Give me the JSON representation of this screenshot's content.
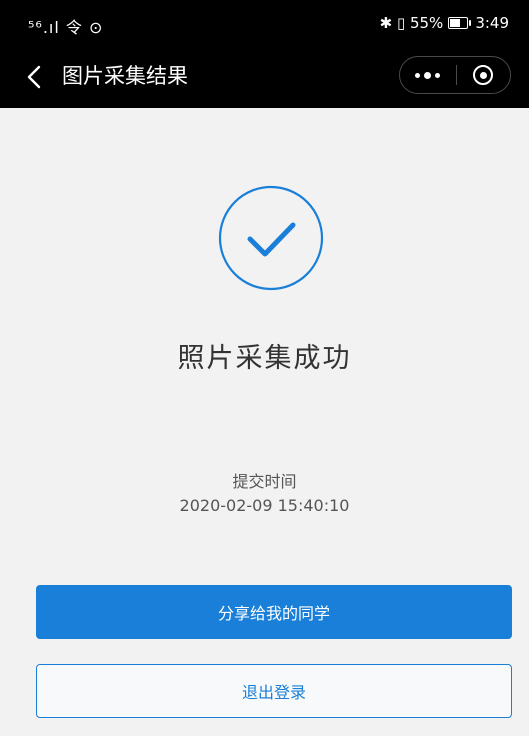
{
  "status_bar": {
    "left_icons": "⁵⁶.ıl 令 ⊙",
    "right_text": "✱ ▯ 55%",
    "time": "3:49"
  },
  "nav": {
    "title": "图片采集结果",
    "back_icon": "chevron-left-icon",
    "more_icon": "more-dots-icon",
    "close_icon": "target-icon"
  },
  "result": {
    "title": "照片采集成功",
    "icon": "check-circle-icon",
    "accent_color": "#1a7fd8"
  },
  "submission": {
    "label": "提交时间",
    "time": "2020-02-09 15:40:10"
  },
  "buttons": {
    "share_label": "分享给我的同学",
    "logout_label": "退出登录"
  }
}
